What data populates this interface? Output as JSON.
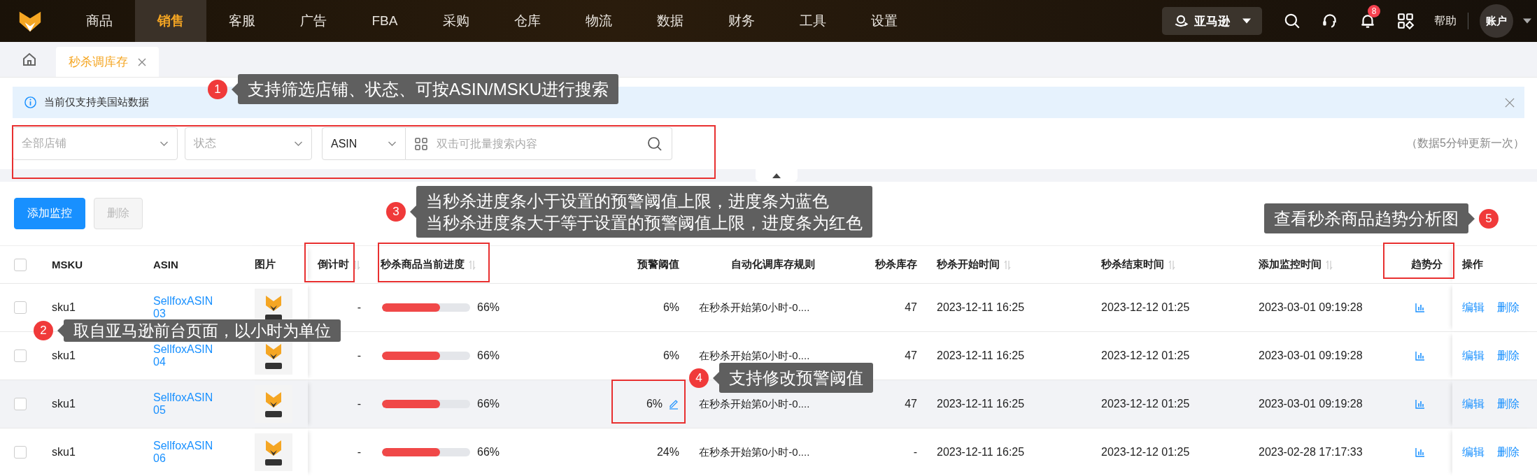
{
  "nav": {
    "items": [
      {
        "label": "商品",
        "selected": false
      },
      {
        "label": "销售",
        "selected": true
      },
      {
        "label": "客服",
        "selected": false
      },
      {
        "label": "广告",
        "selected": false
      },
      {
        "label": "FBA",
        "selected": false
      },
      {
        "label": "采购",
        "selected": false
      },
      {
        "label": "仓库",
        "selected": false
      },
      {
        "label": "物流",
        "selected": false
      },
      {
        "label": "数据",
        "selected": false
      },
      {
        "label": "财务",
        "selected": false
      },
      {
        "label": "工具",
        "selected": false
      },
      {
        "label": "设置",
        "selected": false
      }
    ],
    "marketplace": "亚马逊",
    "notification_count": "8",
    "help": "帮助",
    "account": "账户"
  },
  "tabs": [
    {
      "label": "秒杀调库存",
      "selected": true
    }
  ],
  "notice": "当前仅支持美国站数据",
  "filters": {
    "shop_placeholder": "全部店铺",
    "status_placeholder": "状态",
    "search_type": "ASIN",
    "search_placeholder": "双击可批量搜索内容",
    "update_note": "（数据5分钟更新一次）"
  },
  "actions": [
    {
      "label": "添加监控",
      "kind": "primary",
      "disabled": false
    },
    {
      "label": "删除",
      "kind": "default",
      "disabled": true
    }
  ],
  "table": {
    "all_checked": false,
    "columns": [
      {
        "label": "MSKU",
        "sortable": false
      },
      {
        "label": "ASIN",
        "sortable": false
      },
      {
        "label": "图片",
        "sortable": false
      },
      {
        "label": "倒计时",
        "sortable": true
      },
      {
        "label": "秒杀商品当前进度",
        "sortable": true
      },
      {
        "label": "预警阈值",
        "sortable": false
      },
      {
        "label": "自动化调库存规则",
        "sortable": false
      },
      {
        "label": "秒杀库存",
        "sortable": false
      },
      {
        "label": "秒杀开始时间",
        "sortable": true
      },
      {
        "label": "秒杀结束时间",
        "sortable": true
      },
      {
        "label": "添加监控时间",
        "sortable": true
      },
      {
        "label": "趋势分",
        "sortable": false
      },
      {
        "label": "操作",
        "sortable": false
      }
    ],
    "rows": [
      {
        "checked": false,
        "highlighted": false,
        "msku": "sku1",
        "asin": "SellfoxASIN03",
        "countdown": "-",
        "level": 0.66,
        "over_threshold": true,
        "progress": "66%",
        "threshold": "6%",
        "rule": "在秒杀开始第0小时-0....",
        "stock": "47",
        "start": "2023-12-11 16:25",
        "end": "2023-12-12 01:25",
        "added": "2023-03-01 09:19:28",
        "edit": "编辑",
        "delete": "删除"
      },
      {
        "checked": false,
        "highlighted": false,
        "msku": "sku1",
        "asin": "SellfoxASIN04",
        "countdown": "-",
        "level": 0.66,
        "over_threshold": true,
        "progress": "66%",
        "threshold": "6%",
        "rule": "在秒杀开始第0小时-0....",
        "stock": "47",
        "start": "2023-12-11 16:25",
        "end": "2023-12-12 01:25",
        "added": "2023-03-01 09:19:28",
        "edit": "编辑",
        "delete": "删除"
      },
      {
        "checked": false,
        "highlighted": true,
        "msku": "sku1",
        "asin": "SellfoxASIN05",
        "countdown": "-",
        "level": 0.66,
        "over_threshold": true,
        "progress": "66%",
        "threshold": "6%",
        "rule": "在秒杀开始第0小时-0....",
        "stock": "47",
        "start": "2023-12-11 16:25",
        "end": "2023-12-12 01:25",
        "added": "2023-03-01 09:19:28",
        "edit": "编辑",
        "delete": "删除"
      },
      {
        "checked": false,
        "highlighted": false,
        "msku": "sku1",
        "asin": "SellfoxASIN06",
        "countdown": "-",
        "level": 0.66,
        "over_threshold": true,
        "progress": "66%",
        "threshold": "24%",
        "rule": "在秒杀开始第0小时-0....",
        "stock": "-",
        "start": "2023-12-11 16:25",
        "end": "2023-12-12 01:25",
        "added": "2023-02-28 17:17:33",
        "edit": "编辑",
        "delete": "删除"
      }
    ]
  },
  "annotations": [
    {
      "number": "1",
      "lines": [
        "支持筛选店铺、状态、可按ASIN/MSKU进行搜索"
      ]
    },
    {
      "number": "2",
      "lines": [
        "取自亚马逊前台页面，以小时为单位"
      ]
    },
    {
      "number": "3",
      "lines": [
        "当秒杀进度条小于设置的预警阈值上限，进度条为蓝色",
        "当秒杀进度条大于等于设置的预警阈值上限，进度条为红色"
      ]
    },
    {
      "number": "4",
      "lines": [
        "支持修改预警阈值"
      ]
    },
    {
      "number": "5",
      "lines": [
        "查看秒杀商品趋势分析图"
      ]
    }
  ]
}
